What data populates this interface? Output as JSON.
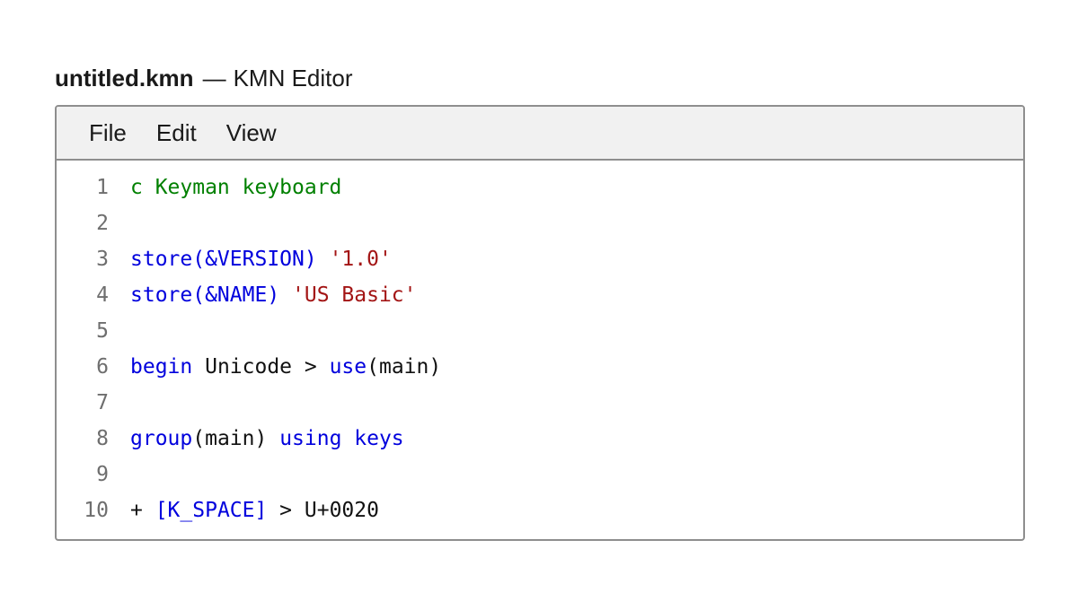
{
  "window": {
    "filename": "untitled.kmn",
    "separator": "—",
    "app_name": "KMN Editor"
  },
  "menu": {
    "items": [
      "File",
      "Edit",
      "View"
    ]
  },
  "colors": {
    "comment": "#008000",
    "keyword": "#0000dd",
    "string": "#a31515",
    "plain": "#111111",
    "line_number": "#6e6e6e"
  },
  "editor": {
    "lines": [
      {
        "number": "1",
        "tokens": [
          {
            "text": "c Keyman keyboard",
            "type": "comment"
          }
        ]
      },
      {
        "number": "2",
        "tokens": []
      },
      {
        "number": "3",
        "tokens": [
          {
            "text": "store(&VERSION)",
            "type": "keyword"
          },
          {
            "text": " ",
            "type": "plain"
          },
          {
            "text": "'1.0'",
            "type": "string"
          }
        ]
      },
      {
        "number": "4",
        "tokens": [
          {
            "text": "store(&NAME)",
            "type": "keyword"
          },
          {
            "text": " ",
            "type": "plain"
          },
          {
            "text": "'US Basic'",
            "type": "string"
          }
        ]
      },
      {
        "number": "5",
        "tokens": []
      },
      {
        "number": "6",
        "tokens": [
          {
            "text": "begin",
            "type": "keyword"
          },
          {
            "text": " Unicode > ",
            "type": "plain"
          },
          {
            "text": "use",
            "type": "keyword"
          },
          {
            "text": "(main)",
            "type": "plain"
          }
        ]
      },
      {
        "number": "7",
        "tokens": []
      },
      {
        "number": "8",
        "tokens": [
          {
            "text": "group",
            "type": "keyword"
          },
          {
            "text": "(main) ",
            "type": "plain"
          },
          {
            "text": "using keys",
            "type": "keyword"
          }
        ]
      },
      {
        "number": "9",
        "tokens": []
      },
      {
        "number": "10",
        "tokens": [
          {
            "text": "+ ",
            "type": "plain"
          },
          {
            "text": "[K_SPACE]",
            "type": "keyword"
          },
          {
            "text": " > U+0020",
            "type": "plain"
          }
        ]
      }
    ]
  }
}
